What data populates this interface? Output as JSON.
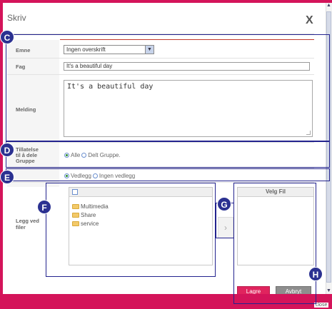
{
  "dialog": {
    "title": "Skriv",
    "close_label": "X"
  },
  "form": {
    "subject_label": "Emne",
    "subject_value": "Ingen overskrift",
    "subject_options": [
      "Ingen overskrift"
    ],
    "course_label": "Fag",
    "course_value": "It's a beautiful day",
    "message_label": "Melding",
    "message_value": "It's a beautiful day",
    "share_label": "Tillatelse til å dele Gruppe",
    "share_options": [
      "Alle",
      "Delt Gruppe."
    ],
    "share_selected": "Alle",
    "attach_options": [
      "Vedlegg",
      "Ingen vedlegg"
    ],
    "attach_selected": "Vedlegg",
    "files_label": "Legg ved filer"
  },
  "file_browser": {
    "items": [
      "Multimedia",
      "Share",
      "service"
    ],
    "transfer_icon": "chevron-right-icon"
  },
  "selected_files": {
    "header": "Velg Fil",
    "items": []
  },
  "buttons": {
    "save": "Lagre",
    "cancel": "Avbryt"
  },
  "footer": {
    "close_text": "close"
  },
  "callouts": [
    "C",
    "D",
    "E",
    "F",
    "G",
    "H"
  ],
  "colors": {
    "brand": "#d4145a",
    "callout": "#2b3191",
    "save_button": "#e0245e",
    "cancel_button": "#8e8e8e"
  }
}
